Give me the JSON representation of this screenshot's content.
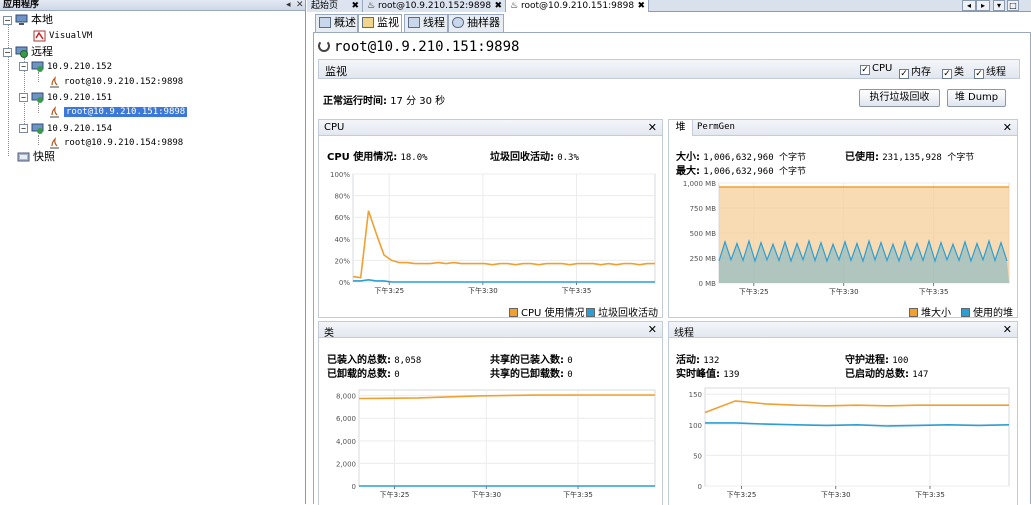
{
  "left_panel": {
    "title": "应用程序",
    "tree": {
      "local": "本地",
      "visualvm": "VisualVM",
      "remote": "远程",
      "host1": "10.9.210.152",
      "host1_conn": "root@10.9.210.152:9898",
      "host2": "10.9.210.151",
      "host2_conn": "root@10.9.210.151:9898",
      "host3": "10.9.210.154",
      "host3_conn": "root@10.9.210.154:9898",
      "snapshots": "快照"
    }
  },
  "doc_tabs": [
    "起始页",
    "root@10.9.210.152:9898",
    "root@10.9.210.151:9898"
  ],
  "sub_tabs": [
    "概述",
    "监视",
    "线程",
    "抽样器"
  ],
  "header": {
    "title": "root@10.9.210.151:9898"
  },
  "monitor": {
    "section": "监视",
    "checkboxes": [
      "CPU",
      "内存",
      "类",
      "线程"
    ],
    "uptime_label": "正常运行时间:",
    "uptime_value": "17 分 30 秒",
    "gc_button": "执行垃圾回收",
    "heap_dump_button": "堆 Dump"
  },
  "cpu_panel": {
    "title": "CPU",
    "usage_label": "CPU 使用情况:",
    "usage_value": "18.0%",
    "gc_label": "垃圾回收活动:",
    "gc_value": "0.3%",
    "legend": [
      "CPU 使用情况",
      "垃圾回收活动"
    ]
  },
  "heap_panel": {
    "tab_heap": "堆",
    "tab_permgen": "PermGen",
    "size_label": "大小:",
    "size_value": "1,006,632,960 个字节",
    "used_label": "已使用:",
    "used_value": "231,135,928 个字节",
    "max_label": "最大:",
    "max_value": "1,006,632,960 个字节",
    "legend": [
      "堆大小",
      "使用的堆"
    ]
  },
  "classes_panel": {
    "title": "类",
    "loaded_label": "已装入的总数:",
    "loaded_value": "8,058",
    "unloaded_label": "已卸载的总数:",
    "unloaded_value": "0",
    "shared_loaded_label": "共享的已装入数:",
    "shared_loaded_value": "0",
    "shared_unloaded_label": "共享的已卸载数:",
    "shared_unloaded_value": "0"
  },
  "threads_panel": {
    "title": "线程",
    "live_label": "活动:",
    "live_value": "132",
    "peak_label": "实时峰值:",
    "peak_value": "139",
    "daemon_label": "守护进程:",
    "daemon_value": "100",
    "started_label": "已启动的总数:",
    "started_value": "147"
  },
  "colors": {
    "orange": "#f0a030",
    "blue": "#2b9fd4",
    "selection": "#3b78d8"
  },
  "chart_data": [
    {
      "type": "line",
      "title": "CPU",
      "x_ticks": [
        "下午3:25",
        "下午3:30",
        "下午3:35"
      ],
      "y_ticks": [
        "0%",
        "20%",
        "40%",
        "60%",
        "80%",
        "100%"
      ],
      "ylim": [
        0,
        100
      ],
      "series": [
        {
          "name": "CPU 使用情况",
          "color": "#f0a030",
          "values": [
            5,
            4,
            66,
            45,
            25,
            20,
            18,
            18,
            17,
            17,
            17,
            18,
            17,
            18,
            17,
            17,
            17,
            17,
            16,
            17,
            17,
            16,
            17,
            17,
            16,
            17,
            17,
            17,
            16,
            17,
            17,
            17,
            16,
            17,
            16,
            17,
            17,
            16,
            17,
            17
          ]
        },
        {
          "name": "垃圾回收活动",
          "color": "#2b9fd4",
          "values": [
            1,
            1,
            2,
            1,
            1,
            0,
            0,
            0,
            0,
            0,
            0,
            0,
            0,
            0,
            0,
            0,
            0,
            0,
            0,
            0,
            0,
            0,
            0,
            0,
            0,
            0,
            0,
            0,
            0,
            0,
            0,
            0,
            0,
            0,
            0,
            0,
            0,
            0,
            0,
            0
          ]
        }
      ]
    },
    {
      "type": "area",
      "title": "堆",
      "x_ticks": [
        "下午3:25",
        "下午3:30",
        "下午3:35"
      ],
      "y_ticks": [
        "0 MB",
        "250 MB",
        "500 MB",
        "750 MB",
        "1,000 MB"
      ],
      "ylim": [
        0,
        1000
      ],
      "series": [
        {
          "name": "堆大小",
          "color": "#f0a030",
          "values": [
            960,
            960
          ]
        },
        {
          "name": "使用的堆",
          "color": "#2b9fd4",
          "low": 220,
          "high": 420
        }
      ]
    },
    {
      "type": "line",
      "title": "类",
      "x_ticks": [
        "下午3:25",
        "下午3:30",
        "下午3:35"
      ],
      "y_ticks": [
        "0",
        "2,000",
        "4,000",
        "6,000",
        "8,000"
      ],
      "ylim": [
        0,
        8500
      ],
      "series": [
        {
          "name": "已装入的总数",
          "color": "#f0a030",
          "values": [
            7750,
            7800,
            7980,
            8050,
            8058,
            8058
          ]
        },
        {
          "name": "共享的已装入数",
          "color": "#2b9fd4",
          "values": [
            0,
            0,
            0,
            0,
            0,
            0
          ]
        }
      ]
    },
    {
      "type": "line",
      "title": "线程",
      "x_ticks": [
        "下午3:25",
        "下午3:30",
        "下午3:35"
      ],
      "y_ticks": [
        "0",
        "50",
        "100",
        "150"
      ],
      "ylim": [
        0,
        160
      ],
      "series": [
        {
          "name": "实时线程",
          "color": "#f0a030",
          "values": [
            120,
            139,
            134,
            132,
            131,
            132,
            131,
            132,
            132,
            132,
            132
          ]
        },
        {
          "name": "守护线程",
          "color": "#2b9fd4",
          "values": [
            103,
            103,
            101,
            100,
            99,
            100,
            98,
            99,
            100,
            99,
            100
          ]
        }
      ]
    }
  ]
}
